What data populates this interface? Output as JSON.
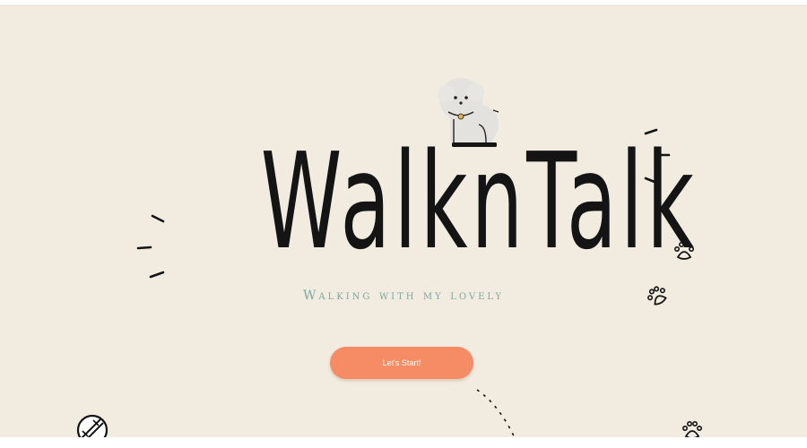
{
  "hero": {
    "title": "WalknTalk",
    "subtitle": "Walking with my lovely",
    "start_button_label": "Let's Start!"
  },
  "icons": {
    "dog": "dog-mascot-icon",
    "paw": "paw-print-icon",
    "ball": "ball-icon"
  },
  "colors": {
    "background": "#f1ebe0",
    "title_text": "#141414",
    "subtitle_text": "#7aaaa0",
    "button": "#f58c66",
    "button_text": "#ffffff"
  }
}
